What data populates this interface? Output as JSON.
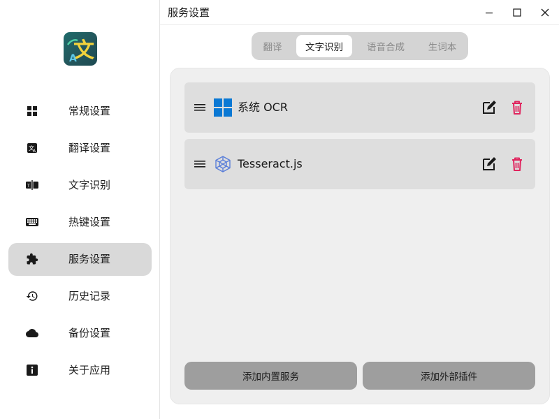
{
  "window": {
    "title": "服务设置",
    "controls": [
      "minimize-icon",
      "maximize-icon",
      "close-icon"
    ]
  },
  "sidebar": {
    "logo": "app-logo-icon",
    "items": [
      {
        "label": "常规设置",
        "icon": "grid-icon",
        "active": false
      },
      {
        "label": "翻译设置",
        "icon": "translate-icon",
        "active": false
      },
      {
        "label": "文字识别",
        "icon": "ocr-icon",
        "active": false
      },
      {
        "label": "热键设置",
        "icon": "keyboard-icon",
        "active": false
      },
      {
        "label": "服务设置",
        "icon": "puzzle-icon",
        "active": true
      },
      {
        "label": "历史记录",
        "icon": "history-icon",
        "active": false
      },
      {
        "label": "备份设置",
        "icon": "cloud-icon",
        "active": false
      },
      {
        "label": "关于应用",
        "icon": "info-icon",
        "active": false
      }
    ]
  },
  "tabs": [
    {
      "label": "翻译",
      "active": false
    },
    {
      "label": "文字识别",
      "active": true
    },
    {
      "label": "语音合成",
      "active": false
    },
    {
      "label": "生词本",
      "active": false
    }
  ],
  "services": [
    {
      "name": "系统 OCR",
      "icon": "windows-icon"
    },
    {
      "name": "Tesseract.js",
      "icon": "tesseract-cube-icon"
    }
  ],
  "actions": {
    "add_builtin": "添加内置服务",
    "add_plugin": "添加外部插件"
  },
  "colors": {
    "sidebar_active_bg": "#d9d9d9",
    "tabs_bg": "#d4d4d4",
    "panel_bg": "#efefef",
    "service_row_bg": "#dedede",
    "button_bg": "#9e9e9e",
    "delete_red": "#e0245e",
    "windows_blue": "#0a78d4",
    "tesseract_blue": "#5b7fd9"
  }
}
